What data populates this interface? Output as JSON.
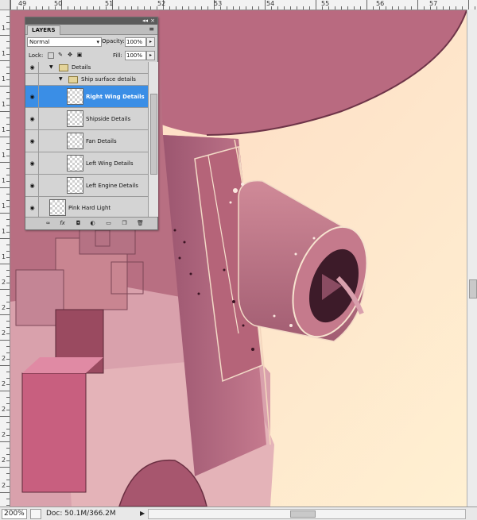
{
  "rulers": {
    "top_labels": [
      "49",
      "50",
      "51",
      "52",
      "53",
      "54",
      "55",
      "56",
      "57"
    ],
    "left_labels": [
      "1",
      "1",
      "1",
      "1",
      "1",
      "1",
      "1",
      "1",
      "1",
      "1",
      "2",
      "2",
      "2",
      "2",
      "2",
      "2",
      "2",
      "2",
      "2",
      "2"
    ]
  },
  "layers_panel": {
    "tab_label": "LAYERS",
    "collapse_label": "◂◂",
    "close_label": "×",
    "menu_label": "≡",
    "blend_mode": "Normal",
    "opacity_label": "Opacity:",
    "opacity_value": "100%",
    "lock_label": "Lock:",
    "fill_label": "Fill:",
    "fill_value": "100%",
    "layers": [
      {
        "name": "Details",
        "kind": "group",
        "level": 0,
        "visible": true
      },
      {
        "name": "Ship surface details",
        "kind": "group",
        "level": 1,
        "visible": false
      },
      {
        "name": "Right Wing Details",
        "kind": "layer",
        "level": 2,
        "visible": true,
        "selected": true
      },
      {
        "name": "Shipside Details",
        "kind": "layer",
        "level": 2,
        "visible": true
      },
      {
        "name": "Fan Details",
        "kind": "layer",
        "level": 2,
        "visible": true
      },
      {
        "name": "Left Wing Details",
        "kind": "layer",
        "level": 2,
        "visible": true
      },
      {
        "name": "Left Engine Details",
        "kind": "layer",
        "level": 2,
        "visible": true
      },
      {
        "name": "Pink Hard Light",
        "kind": "layer",
        "level": 0,
        "visible": true
      }
    ],
    "footer_icons": [
      "link-icon",
      "fx-icon",
      "mask-icon",
      "adjustment-icon",
      "new-group-icon",
      "new-layer-icon",
      "trash-icon"
    ]
  },
  "status_bar": {
    "zoom": "200%",
    "doc_info": "Doc: 50.1M/366.2M",
    "arrow": "▶"
  },
  "colors": {
    "selection": "#3a8ee6",
    "sky": "#fde3c6",
    "hull": "#b9687e"
  }
}
